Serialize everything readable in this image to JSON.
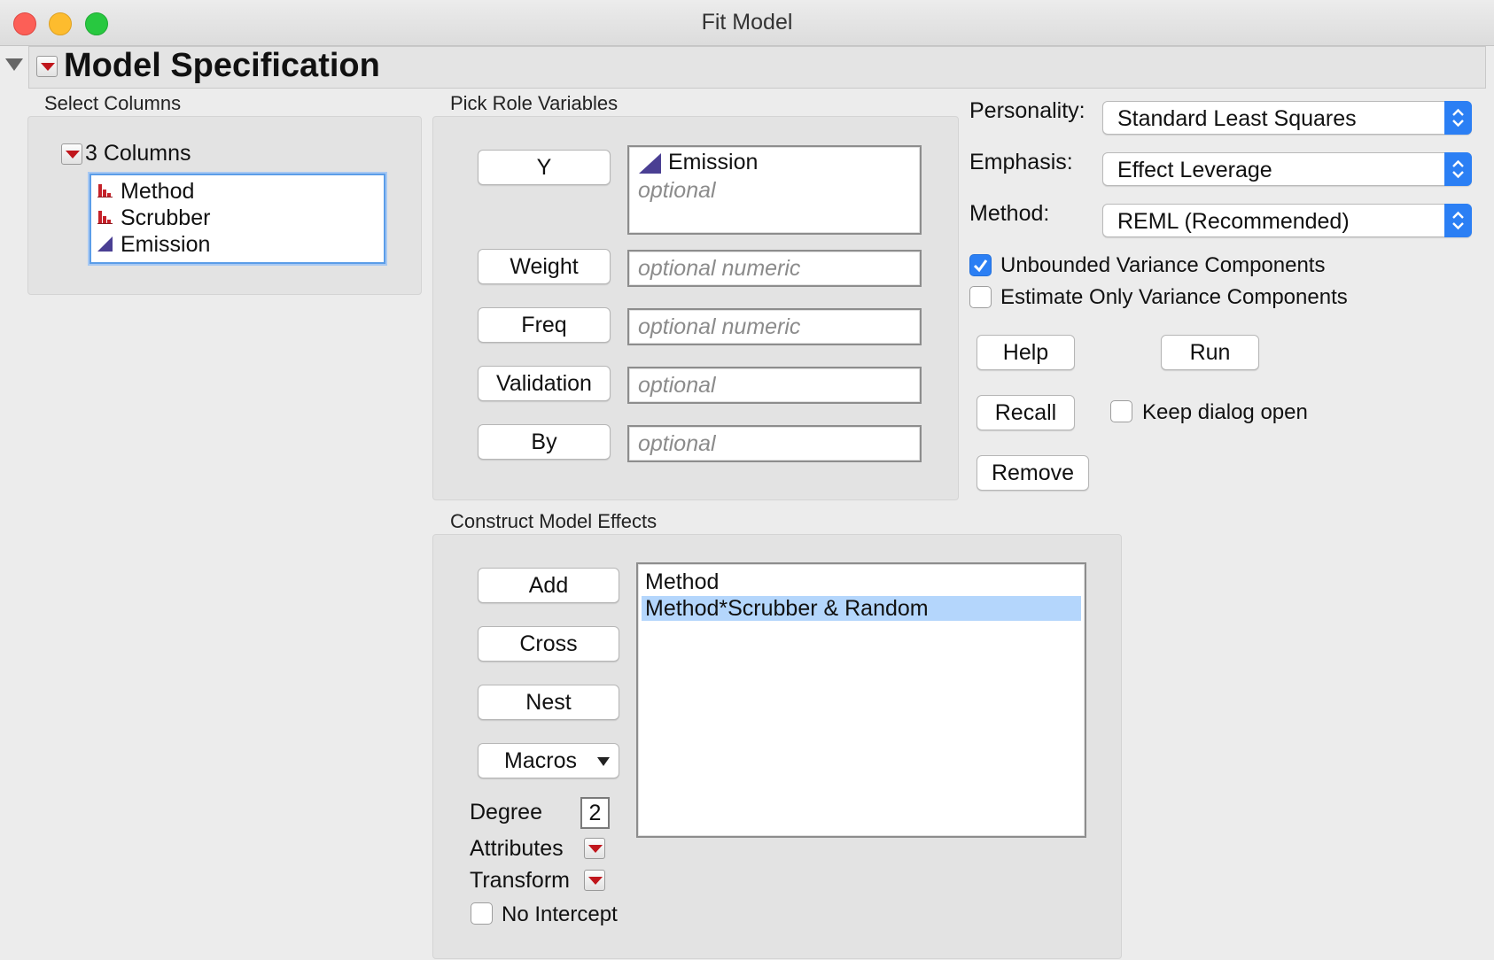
{
  "window": {
    "title": "Fit Model"
  },
  "header": {
    "title": "Model Specification"
  },
  "select_columns": {
    "section_label": "Select Columns",
    "group_label": "3 Columns",
    "columns": [
      {
        "name": "Method",
        "icon": "nominal-bar-icon"
      },
      {
        "name": "Scrubber",
        "icon": "nominal-bar-icon"
      },
      {
        "name": "Emission",
        "icon": "continuous-triangle-icon"
      }
    ]
  },
  "roles": {
    "section_label": "Pick Role Variables",
    "y": {
      "label": "Y",
      "value": "Emission",
      "placeholder": "optional"
    },
    "weight": {
      "label": "Weight",
      "placeholder": "optional numeric"
    },
    "freq": {
      "label": "Freq",
      "placeholder": "optional numeric"
    },
    "validation": {
      "label": "Validation",
      "placeholder": "optional"
    },
    "by": {
      "label": "By",
      "placeholder": "optional"
    }
  },
  "options": {
    "personality": {
      "label": "Personality:",
      "value": "Standard Least Squares"
    },
    "emphasis": {
      "label": "Emphasis:",
      "value": "Effect Leverage"
    },
    "method": {
      "label": "Method:",
      "value": "REML (Recommended)"
    },
    "unbounded": {
      "label": "Unbounded Variance Components",
      "checked": true
    },
    "estimate_only": {
      "label": "Estimate Only Variance Components",
      "checked": false
    }
  },
  "actions": {
    "help": "Help",
    "run": "Run",
    "recall": "Recall",
    "keep_open": {
      "label": "Keep dialog open",
      "checked": false
    },
    "remove": "Remove"
  },
  "effects": {
    "section_label": "Construct Model Effects",
    "add": "Add",
    "cross": "Cross",
    "nest": "Nest",
    "macros": "Macros",
    "degree_label": "Degree",
    "degree_value": "2",
    "attributes_label": "Attributes",
    "transform_label": "Transform",
    "no_intercept": {
      "label": "No Intercept",
      "checked": false
    },
    "items": [
      {
        "text": "Method",
        "selected": false
      },
      {
        "text": "Method*Scrubber & Random",
        "selected": true
      }
    ]
  },
  "colors": {
    "accent": "#2b7ff4",
    "selection": "#b4d6fc",
    "red_button": "#c0161c"
  }
}
